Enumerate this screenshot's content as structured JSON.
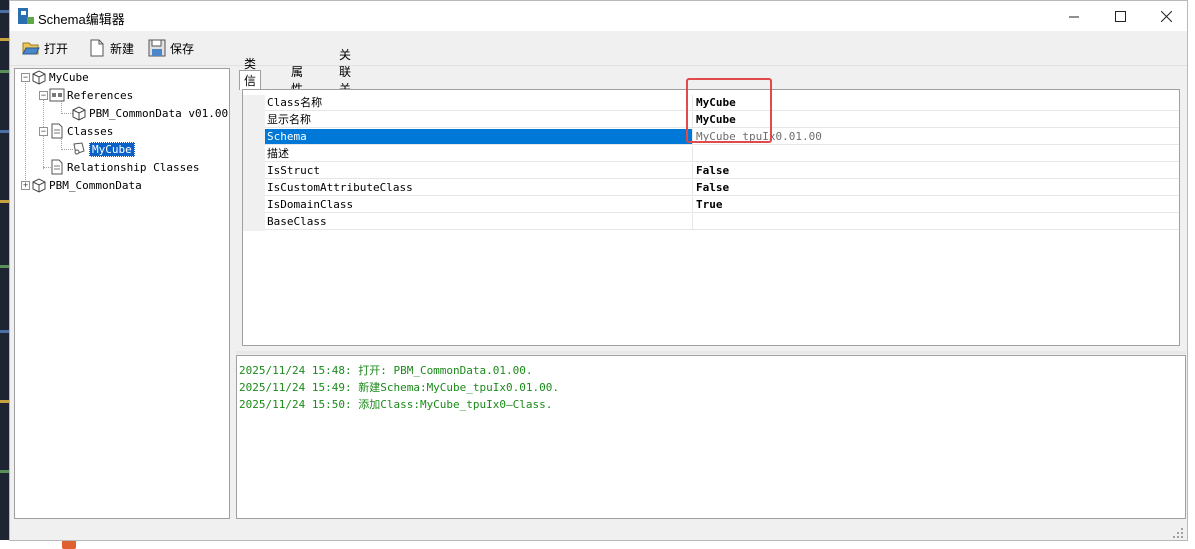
{
  "window": {
    "title": "Schema编辑器"
  },
  "toolbar": {
    "open_label": "打开",
    "new_label": "新建",
    "save_label": "保存"
  },
  "tree": {
    "root": "MyCube",
    "references": "References",
    "ref_item": "PBM_CommonData v01.00",
    "classes": "Classes",
    "class_item": "MyCube",
    "relationship": "Relationship Classes",
    "root2": "PBM_CommonData"
  },
  "tabs": [
    "类信息",
    "属性",
    "关联关系"
  ],
  "properties": [
    {
      "name": "Class名称",
      "value": "MyCube"
    },
    {
      "name": "显示名称",
      "value": "MyCube"
    },
    {
      "name": "Schema",
      "value": "MyCube_tpuIx0.01.00"
    },
    {
      "name": "描述",
      "value": ""
    },
    {
      "name": "IsStruct",
      "value": "False"
    },
    {
      "name": "IsCustomAttributeClass",
      "value": "False"
    },
    {
      "name": "IsDomainClass",
      "value": "True"
    },
    {
      "name": "BaseClass",
      "value": ""
    }
  ],
  "log": [
    "2025/11/24 15:48: 打开: PBM_CommonData.01.00.",
    "2025/11/24 15:49: 新建Schema:MyCube_tpuIx0.01.00.",
    "2025/11/24 15:50: 添加Class:MyCube_tpuIx0—Class."
  ],
  "colors": {
    "selection": "#0078d7",
    "log_text": "#1a8a1a",
    "highlight_box": "#e04a4a"
  }
}
